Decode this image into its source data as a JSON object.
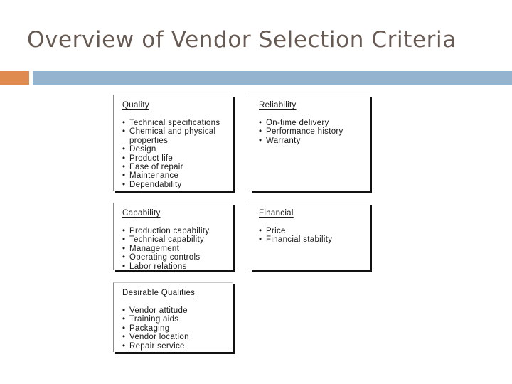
{
  "slide": {
    "title": "Overview of Vendor Selection Criteria",
    "colors": {
      "title_text": "#675a53",
      "accent_square": "#df8a4f",
      "accent_bar": "#93b3cf"
    }
  },
  "criteria": [
    {
      "heading": "Quality",
      "items": [
        "Technical specifications",
        "Chemical and physical properties",
        "Design",
        "Product life",
        "Ease of repair",
        "Maintenance",
        "Dependability"
      ]
    },
    {
      "heading": "Reliability",
      "items": [
        "On-time delivery",
        "Performance history",
        "Warranty"
      ]
    },
    {
      "heading": "Capability",
      "items": [
        "Production capability",
        "Technical capability",
        "Management",
        "Operating controls",
        "Labor relations"
      ]
    },
    {
      "heading": "Financial",
      "items": [
        "Price",
        "Financial stability"
      ]
    },
    {
      "heading": "Desirable Qualities",
      "items": [
        "Vendor attitude",
        "Training aids",
        "Packaging",
        "Vendor location",
        "Repair service"
      ]
    }
  ]
}
